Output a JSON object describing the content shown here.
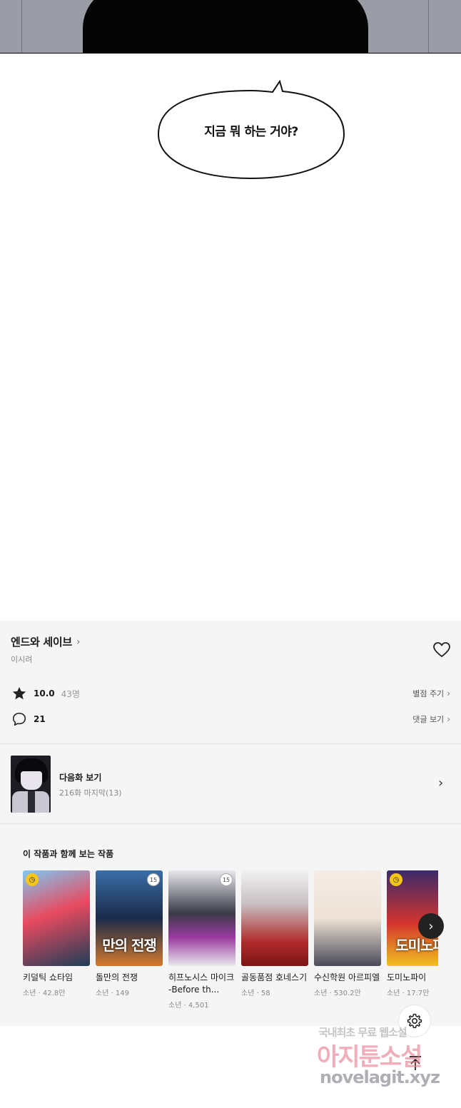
{
  "comic": {
    "speech_bubble": "지금 뭐 하는 거야?"
  },
  "series": {
    "title": "엔드와 세이브",
    "author": "이시려",
    "rating": "10.0",
    "rating_count": "43명",
    "rate_action": "별점 주기",
    "comment_count": "21",
    "comment_action": "댓글 보기"
  },
  "next_episode": {
    "label": "다음화 보기",
    "subtitle": "216화 마지막(13)"
  },
  "recommendations": {
    "heading": "이 작품과 함께 보는 작품",
    "items": [
      {
        "title": "키덜틱 쇼타임",
        "meta": "소년 · 42.8만",
        "cover_text": "",
        "badge": "clock"
      },
      {
        "title": "돌만의 전쟁",
        "meta": "소년 · 149",
        "cover_text": "만의 전쟁",
        "badge": "15"
      },
      {
        "title": "히프노시스 마이크 -Before th...",
        "meta": "소년 · 4,501",
        "cover_text": "",
        "badge": "15"
      },
      {
        "title": "골동품점 호네스기",
        "meta": "소년 · 58",
        "cover_text": "",
        "badge": ""
      },
      {
        "title": "수신학원 아르피엘",
        "meta": "소년 · 530.2만",
        "cover_text": "",
        "badge": ""
      },
      {
        "title": "도미노파이",
        "meta": "소년 · 17.7만",
        "cover_text": "도미노파",
        "badge": "clock"
      }
    ]
  },
  "watermark": {
    "line1": "국내최초 무료 웹소설",
    "line2": "아지툰소설",
    "line3": "novelagit.xyz"
  },
  "icons": {
    "heart": "heart-icon",
    "star": "star-icon",
    "comment": "comment-icon",
    "chevron": "chevron-right-icon",
    "settings": "gear-icon",
    "top": "arrow-up-icon"
  },
  "colors": {
    "info_background": "#f5f5f5",
    "badge_yellow": "#f5c518"
  }
}
